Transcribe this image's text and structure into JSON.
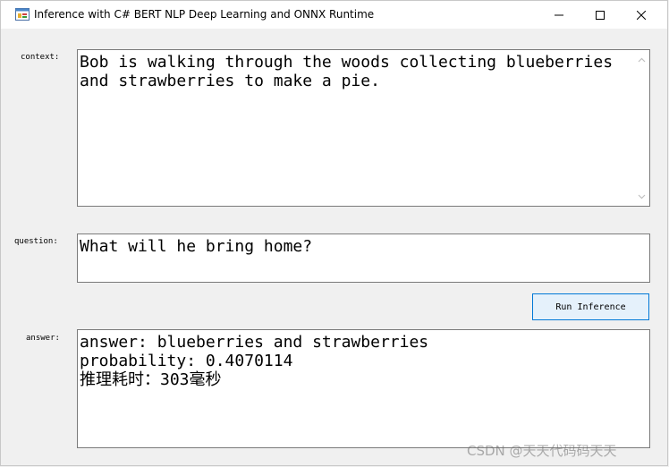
{
  "window": {
    "title": "Inference with C# BERT NLP Deep Learning and ONNX Runtime",
    "icon": "app-form-icon",
    "controls": [
      "minimize-icon",
      "maximize-icon",
      "close-icon"
    ]
  },
  "context": {
    "label": "context:",
    "value": "Bob is walking through the woods collecting blueberries and strawberries to make a pie."
  },
  "question": {
    "label": "question:",
    "value": "What will he bring home?"
  },
  "run_button": {
    "label": "Run Inference"
  },
  "answer": {
    "label": "answer:",
    "value": "answer: blueberries and strawberries\nprobability: 0.4070114\n推理耗时：303毫秒"
  },
  "watermark": {
    "text": "CSDN @天天代码码天天"
  },
  "colors": {
    "accent": "#0078d7",
    "button_bg": "#e5f1fb",
    "window_bg": "#f0f0f0"
  }
}
